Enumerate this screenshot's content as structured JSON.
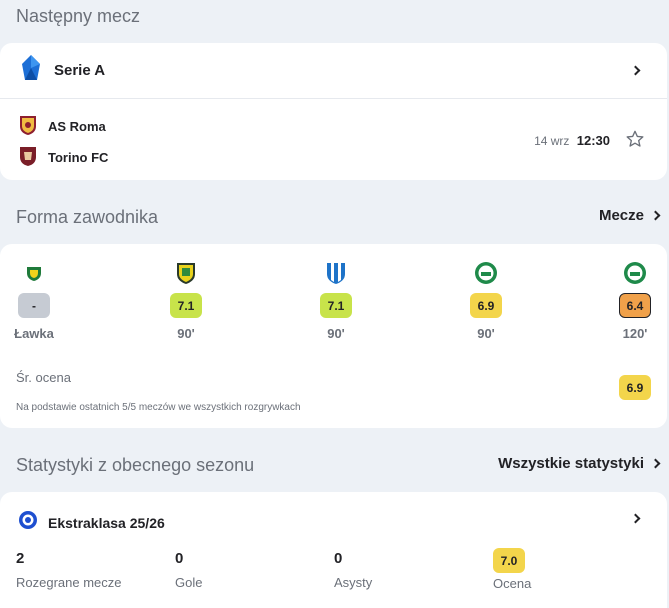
{
  "next_match": {
    "section_title": "Następny mecz",
    "league": "Serie A",
    "home_team": "AS Roma",
    "away_team": "Torino FC",
    "date": "14 wrz",
    "time": "12:30"
  },
  "form": {
    "section_title": "Forma zawodnika",
    "link_label": "Mecze",
    "matches": [
      {
        "team_icon": "club-crest-icon",
        "rating": "-",
        "rating_color": "#c6cbd3",
        "minutes": "Ławka"
      },
      {
        "team_icon": "club-crest-icon",
        "rating": "7.1",
        "rating_color": "#c8e34a",
        "minutes": "90'"
      },
      {
        "team_icon": "club-crest-icon",
        "rating": "7.1",
        "rating_color": "#c8e34a",
        "minutes": "90'"
      },
      {
        "team_icon": "club-crest-icon",
        "rating": "6.9",
        "rating_color": "#f3d54b",
        "minutes": "90'"
      },
      {
        "team_icon": "club-crest-icon",
        "rating": "6.4",
        "rating_color": "#f0a14a",
        "minutes": "120'"
      }
    ],
    "avg_label": "Śr. ocena",
    "avg_value": "6.9",
    "footnote": "Na podstawie ostatnich 5/5 meczów we wszystkich rozgrywkach"
  },
  "season_stats": {
    "section_title": "Statystyki z obecnego sezonu",
    "link_label": "Wszystkie statystyki",
    "competition": "Ekstraklasa 25/26",
    "stats": [
      {
        "value": "2",
        "label": "Rozegrane mecze"
      },
      {
        "value": "0",
        "label": "Gole"
      },
      {
        "value": "0",
        "label": "Asysty"
      },
      {
        "value": "7.0",
        "label": "Ocena"
      }
    ]
  }
}
